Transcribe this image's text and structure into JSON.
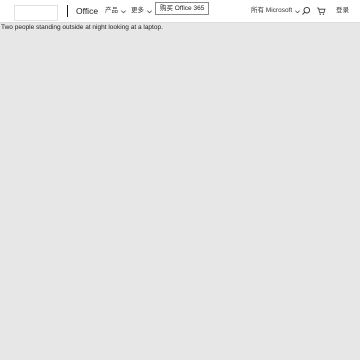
{
  "header": {
    "brand": "Office",
    "nav": {
      "products": "产品",
      "more": "更多"
    },
    "buy_button": "购买 Office 365",
    "all_microsoft": "所有 Microsoft",
    "sign_in": "登录"
  },
  "hero": {
    "image_alt_text": "Two people standing outside at night looking at a laptop."
  },
  "icons": {
    "search": "search-icon",
    "cart": "cart-icon",
    "chevron": "chevron-down-icon"
  }
}
